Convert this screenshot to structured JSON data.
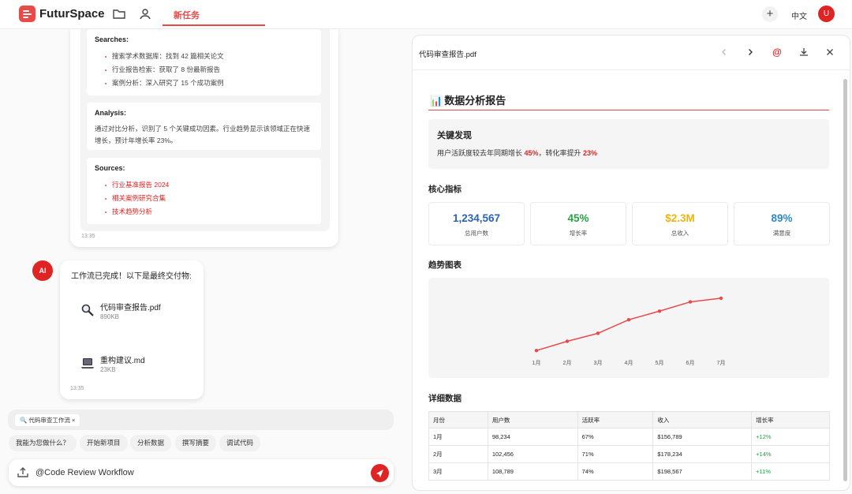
{
  "app": {
    "brand": "FuturSpace",
    "tab_active": "新任务",
    "language": "中文",
    "user_initial": "U"
  },
  "research": {
    "searches_title": "Searches:",
    "searches": [
      "搜索学术数据库：找到 42 篇相关论文",
      "行业报告检索：获取了 8 份最新报告",
      "案例分析：深入研究了 15 个成功案例"
    ],
    "analysis_title": "Analysis:",
    "analysis_text": "通过对比分析，识别了 5 个关键成功因素。行业趋势显示该领域正在快速增长，预计年增长率 23%。",
    "sources_title": "Sources:",
    "sources": [
      "行业基准报告 2024",
      "相关案例研究合集",
      "技术趋势分析"
    ],
    "time": "13:35"
  },
  "final": {
    "avatar": "AI",
    "message": "工作流已完成！以下是最终交付物:",
    "files": [
      {
        "name": "代码审查报告.pdf",
        "size": "890KB",
        "icon": "magnifier-icon"
      },
      {
        "name": "重构建议.md",
        "size": "23KB",
        "icon": "laptop-icon"
      }
    ],
    "time": "13:35"
  },
  "composer": {
    "workflow_chip": "🔍 代码审查工作流 ×",
    "suggestions": [
      "我能为您做什么？",
      "开始新项目",
      "分析数据",
      "撰写摘要",
      "调试代码"
    ],
    "input_value": "@Code Review Workflow"
  },
  "panel": {
    "file_title": "代码审查报告.pdf",
    "report_title": "数据分析报告",
    "report_icon": "📊",
    "key_findings_title": "关键发现",
    "kf_prefix": "用户活跃度较去年同期增长 ",
    "kf_v1": "45%",
    "kf_mid": "，转化率提升 ",
    "kf_v2": "23%",
    "metrics_title": "核心指标",
    "metrics": [
      {
        "value": "1,234,567",
        "label": "总用户数",
        "color": "#2a62b8"
      },
      {
        "value": "45%",
        "label": "增长率",
        "color": "#2e9e47"
      },
      {
        "value": "$2.3M",
        "label": "总收入",
        "color": "#f2b40c"
      },
      {
        "value": "89%",
        "label": "满意度",
        "color": "#2f89c0"
      }
    ],
    "trend_title": "趋势图表",
    "detail_title": "详细数据",
    "table": {
      "headers": [
        "月份",
        "用户数",
        "活跃率",
        "收入",
        "增长率"
      ],
      "rows": [
        [
          "1月",
          "98,234",
          "67%",
          "$156,789",
          "+12%"
        ],
        [
          "2月",
          "102,456",
          "71%",
          "$178,234",
          "+14%"
        ],
        [
          "3月",
          "108,789",
          "74%",
          "$198,567",
          "+11%"
        ]
      ]
    }
  },
  "chart_data": {
    "type": "line",
    "categories": [
      "1月",
      "2月",
      "3月",
      "4月",
      "5月",
      "6月",
      "7月"
    ],
    "values": [
      10,
      25,
      38,
      60,
      74,
      89,
      95
    ],
    "ylim": [
      0,
      100
    ],
    "color": "#e84a4a",
    "grid": false
  }
}
